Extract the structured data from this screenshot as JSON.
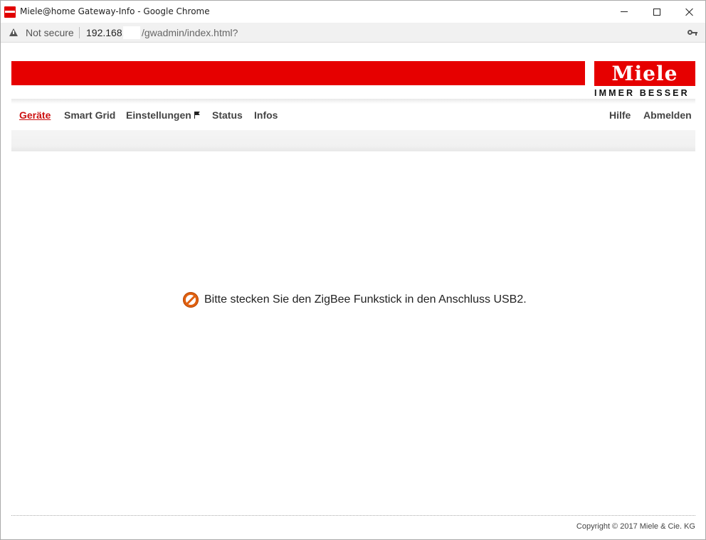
{
  "window": {
    "title": "Miele@home Gateway-Info - Google Chrome"
  },
  "addressbar": {
    "security": "Not secure",
    "url_host": "192.168.",
    "url_path": "/gwadmin/index.html?"
  },
  "header": {
    "logo": "Miele",
    "slogan": "IMMER BESSER"
  },
  "nav": {
    "left": [
      "Geräte",
      "Smart Grid",
      "Einstellungen",
      "Status",
      "Infos"
    ],
    "right": [
      "Hilfe",
      "Abmelden"
    ],
    "active": "Geräte"
  },
  "main": {
    "message": "Bitte stecken Sie den ZigBee Funkstick in den Anschluss USB2."
  },
  "footer": {
    "copyright": "Copyright © 2017 Miele & Cie. KG"
  },
  "colors": {
    "brand_red": "#e60000",
    "active_link": "#cc1111",
    "warning_orange": "#e06010"
  },
  "icons": [
    "miele-favicon",
    "not-secure-warning-icon",
    "key-icon",
    "flag-icon",
    "no-entry-icon"
  ]
}
